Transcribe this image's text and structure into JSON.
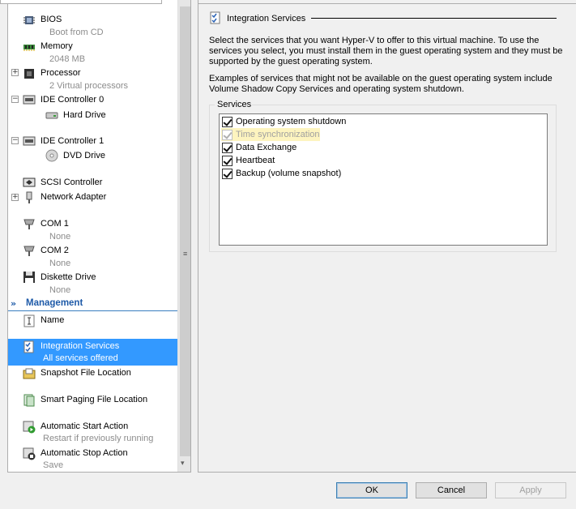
{
  "tree": {
    "nodes": [
      {
        "label": "BIOS",
        "sub": "Boot from CD",
        "icon": "bios-chip-icon",
        "expander": ""
      },
      {
        "label": "Memory",
        "sub": "2048 MB",
        "icon": "memory-icon",
        "expander": ""
      },
      {
        "label": "Processor",
        "sub": "2 Virtual processors",
        "icon": "processor-icon",
        "expander": "+"
      },
      {
        "label": "IDE Controller 0",
        "sub": "",
        "icon": "ide-controller-icon",
        "expander": "−"
      },
      {
        "label": "Hard Drive",
        "sub": "",
        "icon": "hard-drive-icon",
        "expander": ""
      },
      {
        "label": "IDE Controller 1",
        "sub": "",
        "icon": "ide-controller-icon",
        "expander": "−"
      },
      {
        "label": "DVD Drive",
        "sub": "",
        "icon": "dvd-drive-icon",
        "expander": ""
      },
      {
        "label": "SCSI Controller",
        "sub": "",
        "icon": "scsi-controller-icon",
        "expander": ""
      },
      {
        "label": "Network Adapter",
        "sub": "",
        "icon": "network-adapter-icon",
        "expander": "+"
      },
      {
        "label": "COM 1",
        "sub": "None",
        "icon": "com-port-icon",
        "expander": ""
      },
      {
        "label": "COM 2",
        "sub": "None",
        "icon": "com-port-icon",
        "expander": ""
      },
      {
        "label": "Diskette Drive",
        "sub": "None",
        "icon": "diskette-icon",
        "expander": ""
      }
    ],
    "management_header": "Management",
    "management_nodes": [
      {
        "label": "Name",
        "sub": "",
        "icon": "name-icon"
      },
      {
        "label": "Integration Services",
        "sub": "All services offered",
        "icon": "integration-services-icon"
      },
      {
        "label": "Snapshot File Location",
        "sub": "",
        "icon": "snapshot-folder-icon"
      },
      {
        "label": "Smart Paging File Location",
        "sub": "",
        "icon": "paging-file-icon"
      },
      {
        "label": "Automatic Start Action",
        "sub": "Restart if previously running",
        "icon": "start-action-icon"
      },
      {
        "label": "Automatic Stop Action",
        "sub": "Save",
        "icon": "stop-action-icon"
      }
    ]
  },
  "panel": {
    "title": "Integration Services",
    "description1": "Select the services that you want Hyper-V to offer to this virtual machine. To use the services you select, you must install them in the guest operating system and they must be supported by the guest operating system.",
    "description2": "Examples of services that might not be available on the guest operating system include Volume Shadow Copy Services and operating system shutdown.",
    "services_label": "Services",
    "services": [
      {
        "label": "Operating system shutdown",
        "checked": true,
        "enabled": true
      },
      {
        "label": "Time synchronization",
        "checked": true,
        "enabled": false
      },
      {
        "label": "Data Exchange",
        "checked": true,
        "enabled": true
      },
      {
        "label": "Heartbeat",
        "checked": true,
        "enabled": true
      },
      {
        "label": "Backup (volume snapshot)",
        "checked": true,
        "enabled": true
      }
    ]
  },
  "buttons": {
    "ok": "OK",
    "cancel": "Cancel",
    "apply": "Apply"
  },
  "colors": {
    "selection": "#3399ff",
    "management_header": "#1e5aa8",
    "disabled_highlight": "#fdf4bf"
  }
}
